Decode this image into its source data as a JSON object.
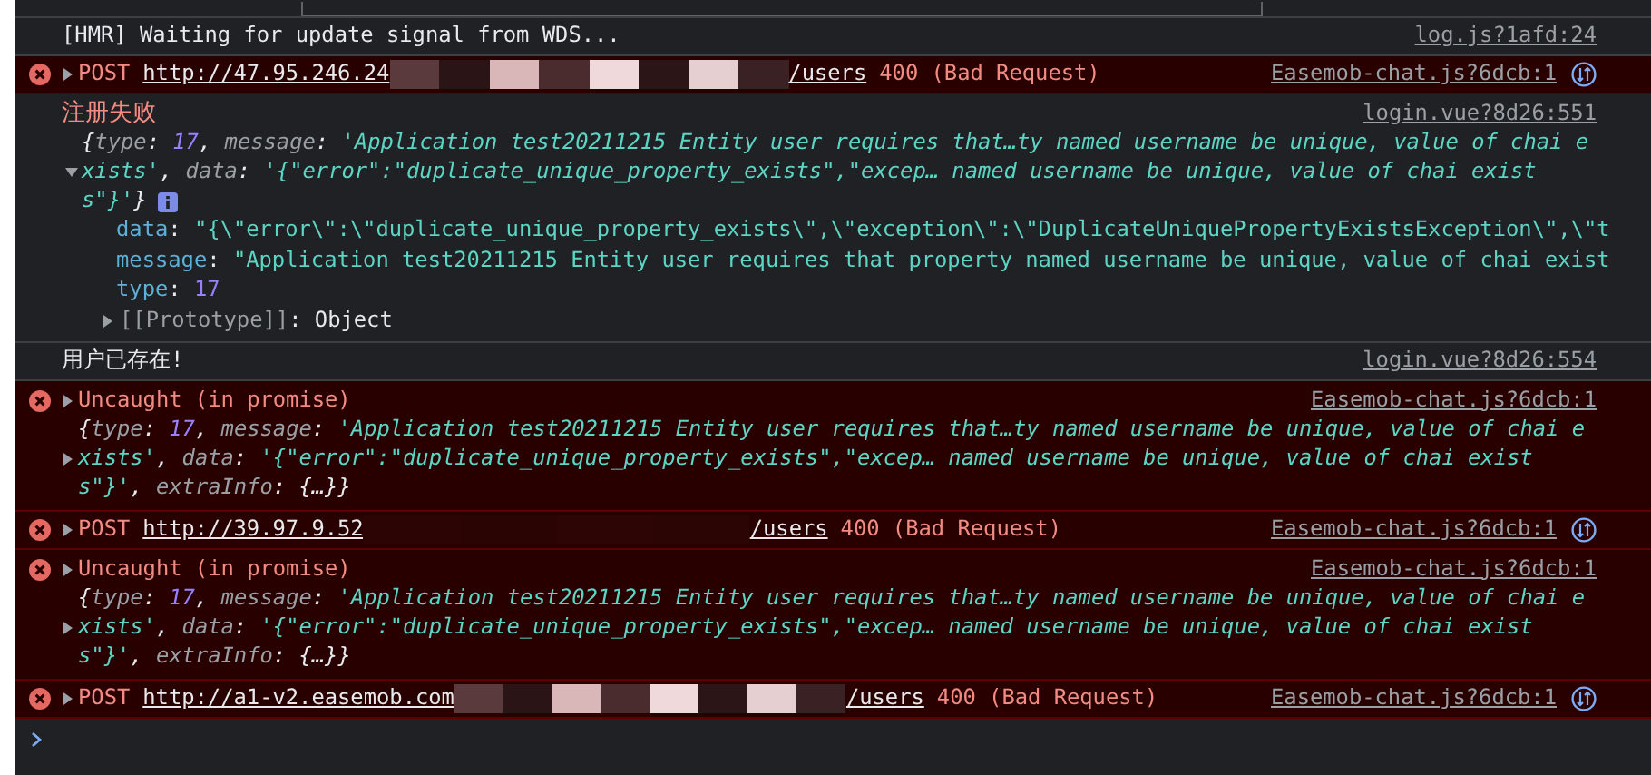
{
  "messages": [
    {
      "kind": "log",
      "text": "[HMR] Waiting for update signal from WDS...",
      "source": "log.js?1afd:24"
    },
    {
      "kind": "network",
      "expanded": false,
      "method": "POST",
      "url_start": "http://47.95.246.24",
      "url_end": "/users",
      "status": "400 (Bad Request)",
      "source": "Easemob-chat.js?6dcb:1"
    },
    {
      "kind": "object_log",
      "label": "注册失败",
      "source": "login.vue?8d26:551",
      "expanded": true,
      "summary": [
        [
          {
            "kind": "punct",
            "text": "{"
          },
          {
            "kind": "key",
            "text": "type"
          },
          {
            "kind": "punct",
            "text": ": "
          },
          {
            "kind": "number",
            "text": "17"
          },
          {
            "kind": "punct",
            "text": ", "
          },
          {
            "kind": "key",
            "text": "message"
          },
          {
            "kind": "punct",
            "text": ": "
          },
          {
            "kind": "string",
            "text": "'Application test20211215 Entity user requires that…ty named username be unique, value of chai e"
          }
        ],
        [
          {
            "kind": "string",
            "text": "xists'"
          },
          {
            "kind": "punct",
            "text": ", "
          },
          {
            "kind": "key",
            "text": "data"
          },
          {
            "kind": "punct",
            "text": ": "
          },
          {
            "kind": "string",
            "text": "'{\"error\":\"duplicate_unique_property_exists\",\"excep… named username be unique, value of chai exist"
          }
        ],
        [
          {
            "kind": "string",
            "text": "s\"}'"
          },
          {
            "kind": "punct",
            "text": "}"
          }
        ]
      ],
      "properties": [
        {
          "key": "data",
          "sep": ": ",
          "value": "\"{\\\"error\\\":\\\"duplicate_unique_property_exists\\\",\\\"exception\\\":\\\"DuplicateUniquePropertyExistsException\\\",\\\"t",
          "kind": "string"
        },
        {
          "key": "message",
          "sep": ": ",
          "value": "\"Application test20211215 Entity user requires that property named username be unique, value of chai exist",
          "kind": "string"
        },
        {
          "key": "type",
          "sep": ": ",
          "value": "17",
          "kind": "number"
        }
      ],
      "prototype": {
        "key": "[[Prototype]]",
        "sep": ": ",
        "value": "Object",
        "expanded": false
      }
    },
    {
      "kind": "log",
      "text": "用户已存在!",
      "source": "login.vue?8d26:554"
    },
    {
      "kind": "error_object",
      "label": "Uncaught (in promise)",
      "label_expanded": false,
      "expanded": false,
      "source": "Easemob-chat.js?6dcb:1",
      "summary": [
        [
          {
            "kind": "punct",
            "text": "{"
          },
          {
            "kind": "key",
            "text": "type"
          },
          {
            "kind": "punct",
            "text": ": "
          },
          {
            "kind": "number",
            "text": "17"
          },
          {
            "kind": "punct",
            "text": ", "
          },
          {
            "kind": "key",
            "text": "message"
          },
          {
            "kind": "punct",
            "text": ": "
          },
          {
            "kind": "string",
            "text": "'Application test20211215 Entity user requires that…ty named username be unique, value of chai e"
          }
        ],
        [
          {
            "kind": "string",
            "text": "xists'"
          },
          {
            "kind": "punct",
            "text": ", "
          },
          {
            "kind": "key",
            "text": "data"
          },
          {
            "kind": "punct",
            "text": ": "
          },
          {
            "kind": "string",
            "text": "'{\"error\":\"duplicate_unique_property_exists\",\"excep… named username be unique, value of chai exist"
          }
        ],
        [
          {
            "kind": "string",
            "text": "s\"}'"
          },
          {
            "kind": "punct",
            "text": ", "
          },
          {
            "kind": "key",
            "text": "extraInfo"
          },
          {
            "kind": "punct",
            "text": ": "
          },
          {
            "kind": "punct",
            "text": "{…}"
          },
          {
            "kind": "punct",
            "text": "}"
          }
        ]
      ]
    },
    {
      "kind": "network",
      "expanded": false,
      "method": "POST",
      "url_start": "http://39.97.9.52",
      "url_end": "/users",
      "status": "400 (Bad Request)",
      "source": "Easemob-chat.js?6dcb:1"
    },
    {
      "kind": "error_object",
      "label": "Uncaught (in promise)",
      "label_expanded": false,
      "expanded": false,
      "source": "Easemob-chat.js?6dcb:1",
      "summary": [
        [
          {
            "kind": "punct",
            "text": "{"
          },
          {
            "kind": "key",
            "text": "type"
          },
          {
            "kind": "punct",
            "text": ": "
          },
          {
            "kind": "number",
            "text": "17"
          },
          {
            "kind": "punct",
            "text": ", "
          },
          {
            "kind": "key",
            "text": "message"
          },
          {
            "kind": "punct",
            "text": ": "
          },
          {
            "kind": "string",
            "text": "'Application test20211215 Entity user requires that…ty named username be unique, value of chai e"
          }
        ],
        [
          {
            "kind": "string",
            "text": "xists'"
          },
          {
            "kind": "punct",
            "text": ", "
          },
          {
            "kind": "key",
            "text": "data"
          },
          {
            "kind": "punct",
            "text": ": "
          },
          {
            "kind": "string",
            "text": "'{\"error\":\"duplicate_unique_property_exists\",\"excep… named username be unique, value of chai exist"
          }
        ],
        [
          {
            "kind": "string",
            "text": "s\"}'"
          },
          {
            "kind": "punct",
            "text": ", "
          },
          {
            "kind": "key",
            "text": "extraInfo"
          },
          {
            "kind": "punct",
            "text": ": "
          },
          {
            "kind": "punct",
            "text": "{…}"
          },
          {
            "kind": "punct",
            "text": "}"
          }
        ]
      ]
    },
    {
      "kind": "network",
      "expanded": false,
      "method": "POST",
      "url_start": "http://a1-v2.easemob.com",
      "url_end": "/users",
      "status": "400 (Bad Request)",
      "source": "Easemob-chat.js?6dcb:1"
    }
  ]
}
